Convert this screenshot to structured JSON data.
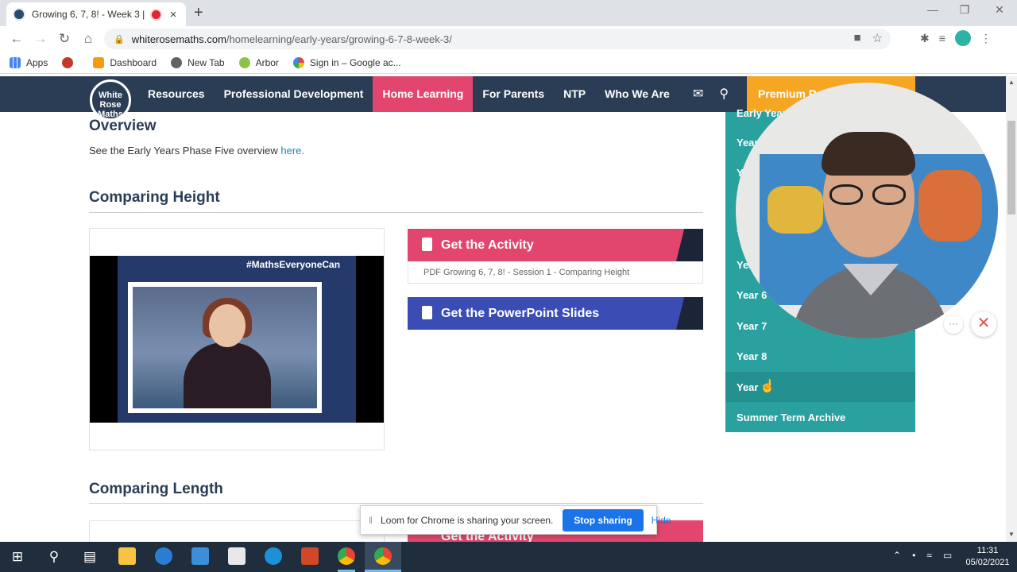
{
  "browser": {
    "tab_title": "Growing 6, 7, 8! - Week 3 | W",
    "new_tab_glyph": "+",
    "tab_close_glyph": "×",
    "url_domain": "whiterosemaths.com",
    "url_path": "/homelearning/early-years/growing-6-7-8-week-3/",
    "bookmarks": [
      "Apps",
      "Dashboard",
      "New Tab",
      "Arbor",
      "Sign in – Google ac..."
    ],
    "icons": [
      "back-icon",
      "forward-icon",
      "reload-icon",
      "home-icon",
      "lock-icon",
      "camera-icon",
      "star-icon",
      "extensions-icon",
      "reading-list-icon",
      "menu-icon"
    ]
  },
  "site": {
    "logo_text": "White Rose Maths",
    "nav": [
      "Resources",
      "Professional Development",
      "Home Learning",
      "For Parents",
      "NTP",
      "Who We Are"
    ],
    "active_nav": "Home Learning",
    "premium_label": "Premium Re",
    "colors": {
      "nav_bg": "#2b3d55",
      "active": "#e2466f",
      "premium": "#f5a623",
      "menu": "#2aa09f",
      "ppt": "#3b4db4"
    }
  },
  "content": {
    "overview_heading": "Overview",
    "overview_text": "See the Early Years Phase Five overview ",
    "overview_link": "here.",
    "section1_heading": "Comparing Height",
    "video_hashtag": "#MathsEveryoneCan",
    "activity_btn": "Get the Activity",
    "pdf_caption": "PDF Growing 6, 7, 8! - Session 1 - Comparing Height",
    "ppt_btn": "Get the PowerPoint Slides",
    "section2_heading": "Comparing Length",
    "activity_btn2": "Get the Activity"
  },
  "year_menu": {
    "items": [
      "Early Year",
      "Year 1",
      "Year",
      "Y",
      "Y",
      "Year",
      "Year 6",
      "Year 7",
      "Year 8",
      "Year",
      "Summer Term Archive"
    ]
  },
  "loom": {
    "message": "Loom for Chrome is sharing your screen.",
    "stop_label": "Stop sharing",
    "hide_label": "Hide",
    "more_glyph": "···",
    "close_glyph": "✕"
  },
  "taskbar": {
    "time": "11:31",
    "date": "05/02/2021"
  }
}
